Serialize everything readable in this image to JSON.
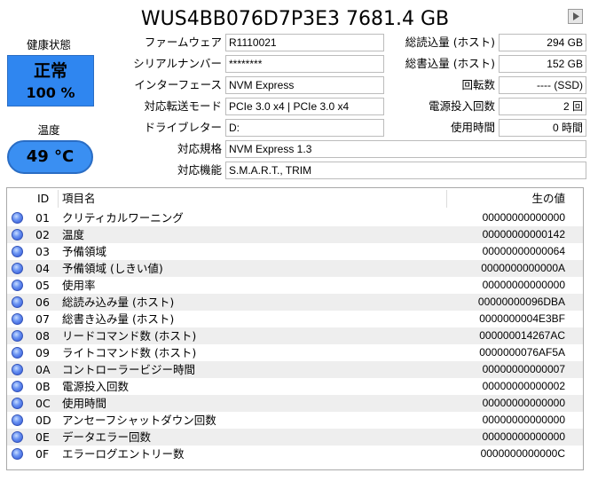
{
  "title": "WUS4BB076D7P3E3 7681.4 GB",
  "health": {
    "label": "健康状態",
    "status": "正常",
    "percent": "100 %"
  },
  "temperature": {
    "label": "温度",
    "value": "49 °C"
  },
  "info_left": [
    {
      "label": "ファームウェア",
      "value": "R1110021"
    },
    {
      "label": "シリアルナンバー",
      "value": "********"
    },
    {
      "label": "インターフェース",
      "value": "NVM Express"
    },
    {
      "label": "対応転送モード",
      "value": "PCIe 3.0 x4 | PCIe 3.0 x4"
    },
    {
      "label": "ドライブレター",
      "value": "D:"
    }
  ],
  "info_right": [
    {
      "label": "総読込量 (ホスト)",
      "value": "294 GB"
    },
    {
      "label": "総書込量 (ホスト)",
      "value": "152 GB"
    },
    {
      "label": "回転数",
      "value": "---- (SSD)"
    },
    {
      "label": "電源投入回数",
      "value": "2 回"
    },
    {
      "label": "使用時間",
      "value": "0 時間"
    }
  ],
  "standard": {
    "label": "対応規格",
    "value": "NVM Express 1.3"
  },
  "features": {
    "label": "対応機能",
    "value": "S.M.A.R.T., TRIM"
  },
  "table": {
    "headers": {
      "id": "ID",
      "name": "項目名",
      "raw": "生の値"
    },
    "rows": [
      {
        "id": "01",
        "name": "クリティカルワーニング",
        "raw": "00000000000000"
      },
      {
        "id": "02",
        "name": "温度",
        "raw": "00000000000142"
      },
      {
        "id": "03",
        "name": "予備領域",
        "raw": "00000000000064"
      },
      {
        "id": "04",
        "name": "予備領域 (しきい値)",
        "raw": "0000000000000A"
      },
      {
        "id": "05",
        "name": "使用率",
        "raw": "00000000000000"
      },
      {
        "id": "06",
        "name": "総読み込み量 (ホスト)",
        "raw": "00000000096DBA"
      },
      {
        "id": "07",
        "name": "総書き込み量 (ホスト)",
        "raw": "0000000004E3BF"
      },
      {
        "id": "08",
        "name": "リードコマンド数 (ホスト)",
        "raw": "000000014267AC"
      },
      {
        "id": "09",
        "name": "ライトコマンド数 (ホスト)",
        "raw": "0000000076AF5A"
      },
      {
        "id": "0A",
        "name": "コントローラービジー時間",
        "raw": "00000000000007"
      },
      {
        "id": "0B",
        "name": "電源投入回数",
        "raw": "00000000000002"
      },
      {
        "id": "0C",
        "name": "使用時間",
        "raw": "00000000000000"
      },
      {
        "id": "0D",
        "name": "アンセーフシャットダウン回数",
        "raw": "00000000000000"
      },
      {
        "id": "0E",
        "name": "データエラー回数",
        "raw": "00000000000000"
      },
      {
        "id": "0F",
        "name": "エラーログエントリー数",
        "raw": "0000000000000C"
      }
    ]
  },
  "colors": {
    "status_good": "#2f86f0",
    "alt_row": "#eeeeee"
  }
}
